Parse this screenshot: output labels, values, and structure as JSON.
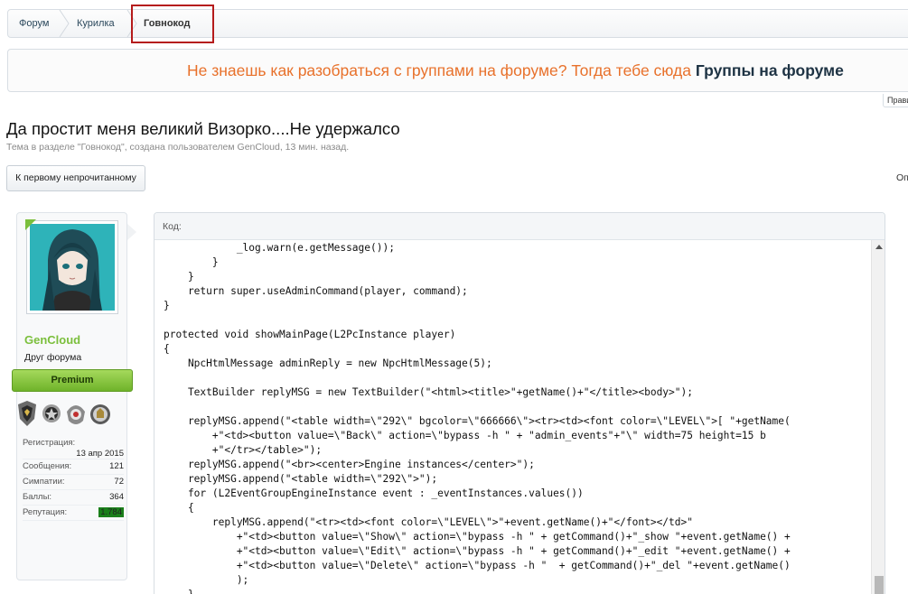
{
  "breadcrumb": {
    "items": [
      {
        "label": "Форум"
      },
      {
        "label": "Курилка"
      },
      {
        "label": "Говнокод"
      }
    ]
  },
  "banner": {
    "text": "Не знаешь как разобраться с группами на форуме? Тогда тебе сюда ",
    "link": "Группы на форуме"
  },
  "rules_tab": "Прави",
  "thread": {
    "title": "Да простит меня великий Визорко....Не удержалсо",
    "meta": "Тема в разделе \"Говнокод\", создана пользователем GenCloud, 13 мин. назад."
  },
  "buttons": {
    "first_unread": "К первому непрочитанному",
    "options": "Оп"
  },
  "user": {
    "name": "GenCloud",
    "title": "Друг форума",
    "premium": "Premium",
    "trophy_icons": [
      "trophy-icon",
      "trophy-icon",
      "trophy-icon",
      "trophy-icon"
    ],
    "stats": [
      {
        "label": "Регистрация:",
        "value": "13 апр 2015"
      },
      {
        "label": "Сообщения:",
        "value": "121"
      },
      {
        "label": "Симпатии:",
        "value": "72"
      },
      {
        "label": "Баллы:",
        "value": "364"
      },
      {
        "label": "Репутация:",
        "value": "1.784"
      }
    ],
    "colors": {
      "username": "#7bbf3c",
      "premium": "#8cc63f",
      "reputation": "#1a7f1a"
    }
  },
  "code": {
    "header": "Код:",
    "lines": [
      "            _log.warn(e.getMessage());",
      "        }",
      "    }",
      "    return super.useAdminCommand(player, command);",
      "}",
      "",
      "protected void showMainPage(L2PcInstance player)",
      "{",
      "    NpcHtmlMessage adminReply = new NpcHtmlMessage(5);",
      "",
      "    TextBuilder replyMSG = new TextBuilder(\"<html><title>\"+getName()+\"</title><body>\");",
      "",
      "    replyMSG.append(\"<table width=\\\"292\\\" bgcolor=\\\"666666\\\"><tr><td><font color=\\\"LEVEL\\\">[ \"+getName(",
      "        +\"<td><button value=\\\"Back\\\" action=\\\"bypass -h \" + \"admin_events\"+\"\\\" width=75 height=15 b",
      "        +\"</tr></table>\");",
      "    replyMSG.append(\"<br><center>Engine instances</center>\");",
      "    replyMSG.append(\"<table width=\\\"292\\\">\");",
      "    for (L2EventGroupEngineInstance event : _eventInstances.values())",
      "    {",
      "        replyMSG.append(\"<tr><td><font color=\\\"LEVEL\\\">\"+event.getName()+\"</font></td>\"",
      "            +\"<td><button value=\\\"Show\\\" action=\\\"bypass -h \" + getCommand()+\"_show \"+event.getName() +",
      "            +\"<td><button value=\\\"Edit\\\" action=\\\"bypass -h \" + getCommand()+\"_edit \"+event.getName() +",
      "            +\"<td><button value=\\\"Delete\\\" action=\\\"bypass -h \"  + getCommand()+\"_del \"+event.getName()",
      "            );",
      "    }"
    ]
  }
}
